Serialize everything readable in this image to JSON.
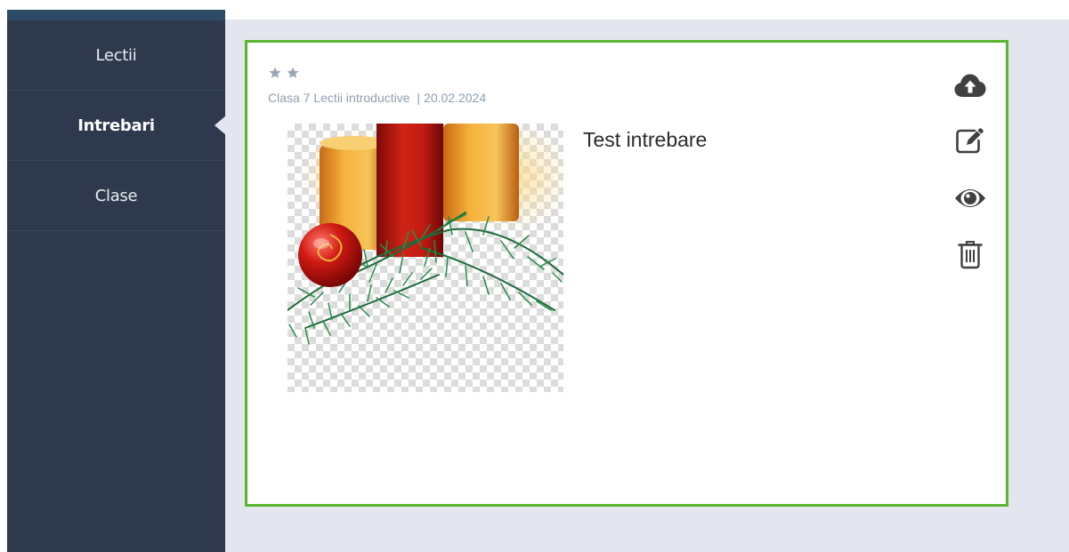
{
  "sidebar": {
    "items": [
      {
        "label": "Lectii",
        "active": false
      },
      {
        "label": "Intrebari",
        "active": true
      },
      {
        "label": "Clase",
        "active": false
      }
    ]
  },
  "card": {
    "rating": 2,
    "class_name": "Clasa 7",
    "lesson_name": "Lectii introductive",
    "separator": "|",
    "date": "20.02.2024",
    "title": "Test intrebare",
    "border_color": "#5cb531",
    "image": {
      "description_icon": "christmas-candles-image"
    },
    "actions": [
      {
        "icon": "cloud-upload-icon"
      },
      {
        "icon": "edit-icon"
      },
      {
        "icon": "eye-icon"
      },
      {
        "icon": "trash-icon"
      }
    ]
  },
  "colors": {
    "sidebar_bg": "#2e394d",
    "main_bg": "#e4e6ef",
    "meta_text": "#8e9fb3",
    "icon": "#444444"
  }
}
